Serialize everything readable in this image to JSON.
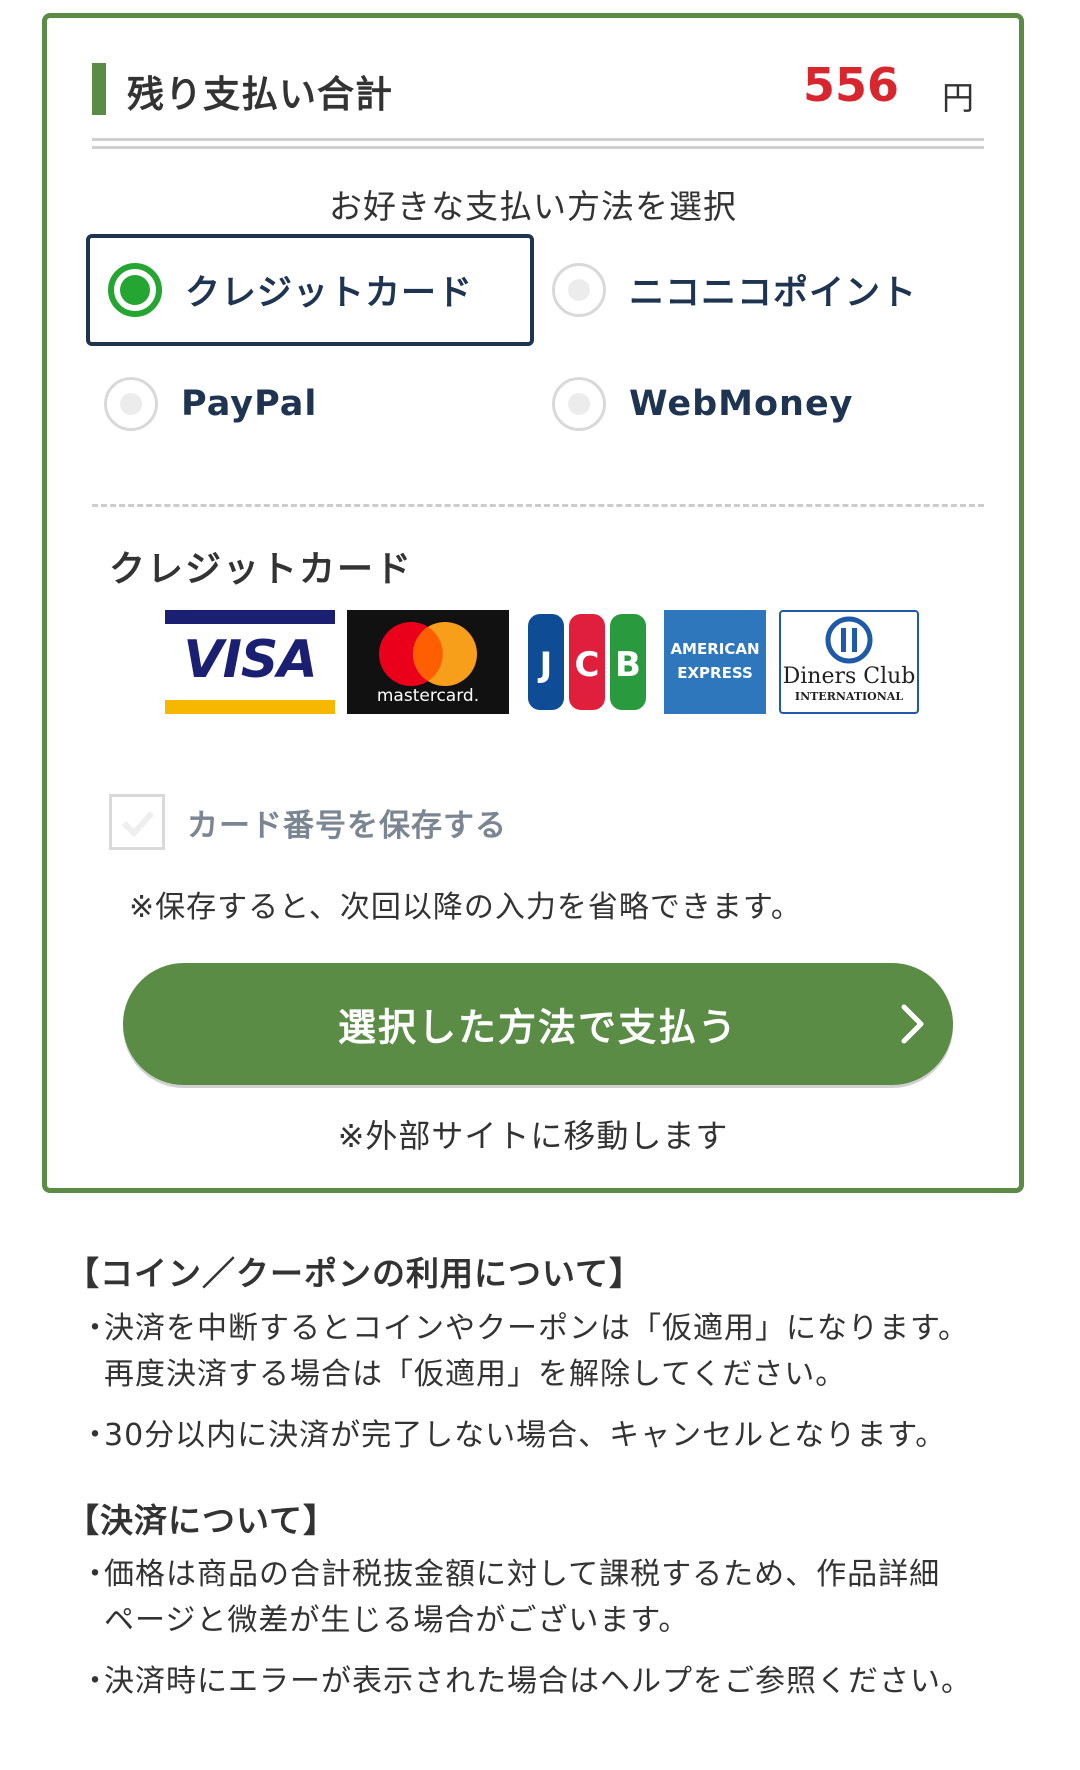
{
  "summary": {
    "title": "残り支払い合計",
    "amount": "556",
    "unit": "円"
  },
  "method_prompt": "お好きな支払い方法を選択",
  "methods": [
    {
      "label": "クレジットカード",
      "selected": true
    },
    {
      "label": "ニコニコポイント",
      "selected": false
    },
    {
      "label": "PayPal",
      "selected": false
    },
    {
      "label": "WebMoney",
      "selected": false
    }
  ],
  "credit_section": {
    "title": "クレジットカード",
    "brands": {
      "visa": "VISA",
      "mastercard": "mastercard.",
      "jcb": "JCB",
      "amex_line1": "AMERICAN",
      "amex_line2": "EXPRESS",
      "diners_line1": "Diners Club",
      "diners_line2": "INTERNATIONAL"
    },
    "save_card_label": "カード番号を保存する",
    "save_card_checked": false,
    "save_note": "※保存すると、次回以降の入力を省略できます。"
  },
  "pay_button": {
    "label": "選択した方法で支払う"
  },
  "external_note": "※外部サイトに移動します",
  "info": [
    {
      "heading": "【コイン／クーポンの利用について】",
      "items": [
        {
          "lines": [
            "決済を中断するとコインやクーポンは「仮適用」になります。",
            "再度決済する場合は「仮適用」を解除してください。"
          ]
        },
        {
          "lines": [
            "30分以内に決済が完了しない場合、キャンセルとなります。"
          ]
        }
      ]
    },
    {
      "heading": "【決済について】",
      "items": [
        {
          "lines": [
            "価格は商品の合計税抜金額に対して課税するため、作品詳細",
            "ページと微差が生じる場合がございます。"
          ]
        },
        {
          "lines": [
            "決済時にエラーが表示された場合はヘルプをご参照ください。"
          ]
        }
      ]
    }
  ],
  "colors": {
    "accent_green": "#5b8c46",
    "radio_green": "#25a633",
    "amount_red": "#d7262d",
    "navy": "#1f3451"
  }
}
